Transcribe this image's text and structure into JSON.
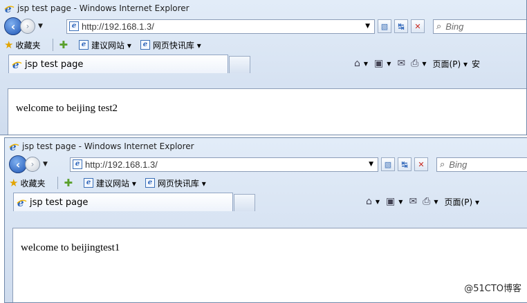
{
  "watermark": "@51CTO博客",
  "windows": [
    {
      "title": "jsp test page - Windows Internet Explorer",
      "address": "http://192.168.1.3/",
      "search_placeholder": "Bing",
      "favorites_label": "收藏夹",
      "fav_links": [
        "建议网站 ▾",
        "网页快讯库 ▾"
      ],
      "tab_title": "jsp test page",
      "page_menu": "页面(P) ▾",
      "safety_menu_partial": "安",
      "body_text": "welcome to beijing test2"
    },
    {
      "title": "jsp test page - Windows Internet Explorer",
      "address": "http://192.168.1.3/",
      "search_placeholder": "Bing",
      "favorites_label": "收藏夹",
      "fav_links": [
        "建议网站 ▾",
        "网页快讯库 ▾"
      ],
      "tab_title": "jsp test page",
      "page_menu": "页面(P) ▾",
      "body_text": "welcome to beijingtest1"
    }
  ],
  "icons": {
    "ie": "ie-logo-icon",
    "back": "back-arrow-icon",
    "forward": "forward-arrow-icon",
    "compat": "compatibility-view-icon",
    "refresh": "refresh-icon",
    "stop": "stop-icon",
    "search": "magnifier-icon",
    "favorites": "star-icon",
    "add_favorites": "add-favorites-icon",
    "home": "home-icon",
    "feeds": "rss-feed-icon",
    "mail": "mail-icon",
    "print": "printer-icon"
  },
  "colors": {
    "ie_blue": "#2b63b8",
    "star": "#e2a400",
    "stop_red": "#c8281e",
    "chrome": "#dbe6f4"
  }
}
